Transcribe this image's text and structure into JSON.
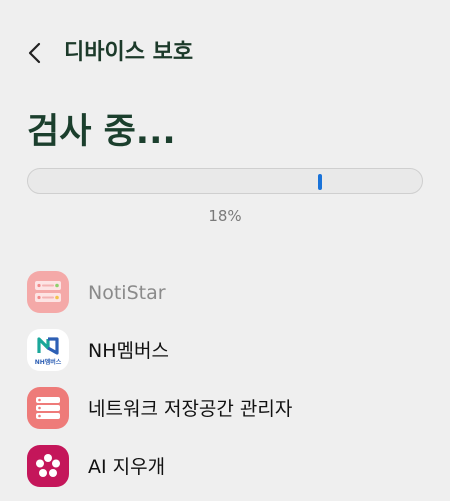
{
  "header": {
    "title": "디바이스 보호",
    "back_icon": "chevron-left-icon"
  },
  "scan": {
    "title": "검사 중...",
    "progress_fraction": 0.74,
    "percent_text": "18%",
    "accent_color": "#1a73d9"
  },
  "apps": [
    {
      "name": "NotiStar",
      "icon": "notistar-app-icon",
      "dimmed": true,
      "icon_color": "#f4a9a8"
    },
    {
      "name": "NH멤버스",
      "icon": "nh-members-app-icon",
      "icon_text": "NH멤버스",
      "icon_color": "#ffffff"
    },
    {
      "name": "네트워크 저장공간 관리자",
      "icon": "network-storage-manager-app-icon",
      "icon_color": "#ee7b79"
    },
    {
      "name": "AI 지우개",
      "icon": "ai-eraser-app-icon",
      "icon_color": "#c4165a"
    }
  ]
}
